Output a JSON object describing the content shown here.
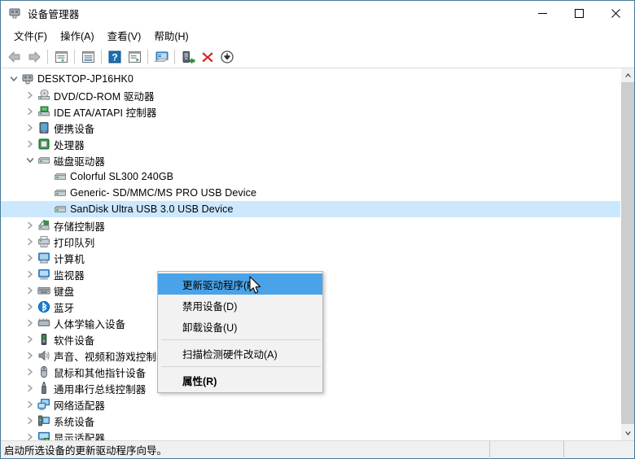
{
  "window": {
    "title": "设备管理器",
    "title_icon": "device-manager-icon",
    "controls": {
      "minimize": "minimize-button",
      "maximize": "maximize-button",
      "close": "close-button"
    }
  },
  "menubar": {
    "items": [
      {
        "label": "文件(F)",
        "name": "menu-file"
      },
      {
        "label": "操作(A)",
        "name": "menu-action"
      },
      {
        "label": "查看(V)",
        "name": "menu-view"
      },
      {
        "label": "帮助(H)",
        "name": "menu-help"
      }
    ]
  },
  "toolbar": {
    "buttons": [
      {
        "icon": "back-arrow-icon",
        "name": "toolbar-back"
      },
      {
        "icon": "forward-arrow-icon",
        "name": "toolbar-forward"
      },
      {
        "icon": "separator",
        "name": "toolbar-separator-1"
      },
      {
        "icon": "show-hidden-devices-icon",
        "name": "toolbar-show-hidden"
      },
      {
        "icon": "separator",
        "name": "toolbar-separator-2"
      },
      {
        "icon": "properties-icon",
        "name": "toolbar-properties"
      },
      {
        "icon": "separator",
        "name": "toolbar-separator-3"
      },
      {
        "icon": "help-icon",
        "name": "toolbar-help"
      },
      {
        "icon": "update-driver-icon",
        "name": "toolbar-update-driver"
      },
      {
        "icon": "separator",
        "name": "toolbar-separator-4"
      },
      {
        "icon": "scan-hardware-changes-icon",
        "name": "toolbar-scan-hardware"
      },
      {
        "icon": "separator",
        "name": "toolbar-separator-5"
      },
      {
        "icon": "enable-device-icon",
        "name": "toolbar-enable-device"
      },
      {
        "icon": "uninstall-device-icon",
        "name": "toolbar-uninstall-device"
      },
      {
        "icon": "disable-device-icon",
        "name": "toolbar-disable-device"
      }
    ]
  },
  "tree": {
    "nodes": [
      {
        "label": "DESKTOP-JP16HK0",
        "depth": 0,
        "state": "expanded",
        "icon": "computer-root-icon",
        "selected": false
      },
      {
        "label": "DVD/CD-ROM 驱动器",
        "depth": 1,
        "state": "collapsed",
        "icon": "dvd-drive-icon",
        "selected": false
      },
      {
        "label": "IDE ATA/ATAPI 控制器",
        "depth": 1,
        "state": "collapsed",
        "icon": "ide-controller-icon",
        "selected": false
      },
      {
        "label": "便携设备",
        "depth": 1,
        "state": "collapsed",
        "icon": "portable-device-icon",
        "selected": false
      },
      {
        "label": "处理器",
        "depth": 1,
        "state": "collapsed",
        "icon": "processor-icon",
        "selected": false
      },
      {
        "label": "磁盘驱动器",
        "depth": 1,
        "state": "expanded",
        "icon": "disk-drive-icon",
        "selected": false
      },
      {
        "label": "Colorful SL300 240GB",
        "depth": 2,
        "state": "leaf",
        "icon": "disk-drive-icon",
        "selected": false
      },
      {
        "label": "Generic- SD/MMC/MS PRO USB Device",
        "depth": 2,
        "state": "leaf",
        "icon": "disk-drive-icon",
        "selected": false
      },
      {
        "label": "SanDisk Ultra USB 3.0 USB Device",
        "depth": 2,
        "state": "leaf",
        "icon": "disk-drive-icon",
        "selected": true
      },
      {
        "label": "存储控制器",
        "depth": 1,
        "state": "collapsed",
        "icon": "storage-controller-icon",
        "selected": false
      },
      {
        "label": "打印队列",
        "depth": 1,
        "state": "collapsed",
        "icon": "print-queue-icon",
        "selected": false
      },
      {
        "label": "计算机",
        "depth": 1,
        "state": "collapsed",
        "icon": "computer-icon",
        "selected": false
      },
      {
        "label": "监视器",
        "depth": 1,
        "state": "collapsed",
        "icon": "monitor-icon",
        "selected": false
      },
      {
        "label": "键盘",
        "depth": 1,
        "state": "collapsed",
        "icon": "keyboard-icon",
        "selected": false
      },
      {
        "label": "蓝牙",
        "depth": 1,
        "state": "collapsed",
        "icon": "bluetooth-icon",
        "selected": false
      },
      {
        "label": "人体学输入设备",
        "depth": 1,
        "state": "collapsed",
        "icon": "hid-device-icon",
        "selected": false
      },
      {
        "label": "软件设备",
        "depth": 1,
        "state": "collapsed",
        "icon": "software-device-icon",
        "selected": false
      },
      {
        "label": "声音、视频和游戏控制器",
        "depth": 1,
        "state": "collapsed",
        "icon": "sound-controller-icon",
        "selected": false
      },
      {
        "label": "鼠标和其他指针设备",
        "depth": 1,
        "state": "collapsed",
        "icon": "mouse-device-icon",
        "selected": false
      },
      {
        "label": "通用串行总线控制器",
        "depth": 1,
        "state": "collapsed",
        "icon": "usb-controller-icon",
        "selected": false
      },
      {
        "label": "网络适配器",
        "depth": 1,
        "state": "collapsed",
        "icon": "network-adapter-icon",
        "selected": false
      },
      {
        "label": "系统设备",
        "depth": 1,
        "state": "collapsed",
        "icon": "system-device-icon",
        "selected": false
      },
      {
        "label": "显示适配器",
        "depth": 1,
        "state": "collapsed",
        "icon": "display-adapter-icon",
        "selected": false
      }
    ]
  },
  "context_menu": {
    "items": [
      {
        "label": "更新驱动程序(P)",
        "name": "ctx-update-driver",
        "highlighted": true,
        "bold": false
      },
      {
        "label": "禁用设备(D)",
        "name": "ctx-disable-device",
        "highlighted": false,
        "bold": false
      },
      {
        "label": "卸载设备(U)",
        "name": "ctx-uninstall-device",
        "highlighted": false,
        "bold": false
      },
      {
        "label": "扫描检测硬件改动(A)",
        "name": "ctx-scan-hardware",
        "highlighted": false,
        "bold": false
      },
      {
        "label": "属性(R)",
        "name": "ctx-properties",
        "highlighted": false,
        "bold": true
      }
    ]
  },
  "statusbar": {
    "message": "启动所选设备的更新驱动程序向导。"
  },
  "scrollbar": {
    "up_arrow": "scroll-up-arrow-icon",
    "down_arrow": "scroll-down-arrow-icon",
    "thumb": "scroll-thumb"
  },
  "colors": {
    "selection": "#cce8ff",
    "menu_highlight": "#4aa3e8",
    "window_border": "#4a7a96",
    "statusbar_bg": "#f0f0f0",
    "accent_green": "#2e9e46",
    "accent_red": "#d42020",
    "accent_blue": "#1a6fb5"
  }
}
